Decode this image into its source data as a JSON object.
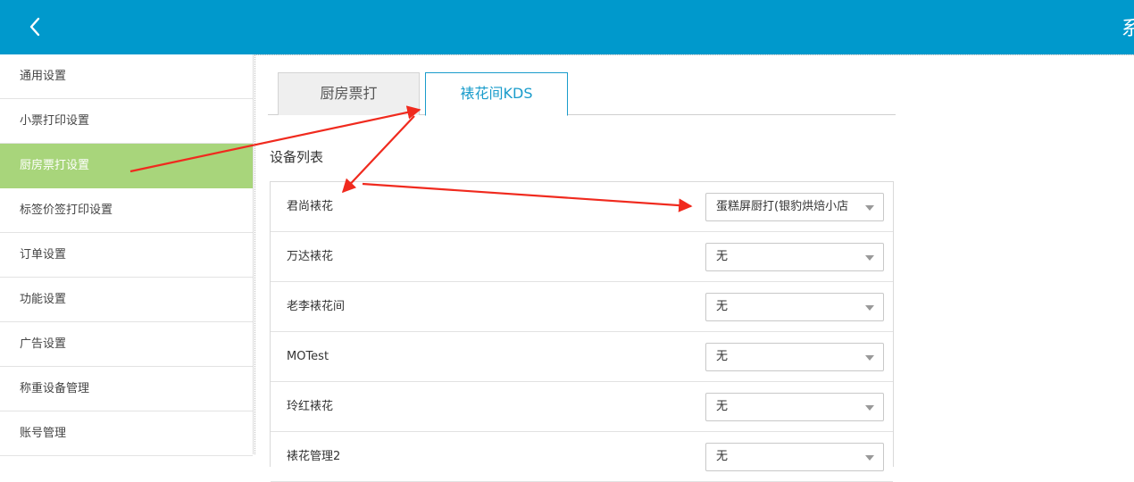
{
  "header": {
    "title": "系",
    "back_icon": "chevron-left-icon",
    "bg_color": "#0099cc"
  },
  "sidebar": {
    "active_color": "#a8d57b",
    "items": [
      {
        "label": "通用设置"
      },
      {
        "label": "小票打印设置"
      },
      {
        "label": "厨房票打设置",
        "active": true
      },
      {
        "label": "标签价签打印设置"
      },
      {
        "label": "订单设置"
      },
      {
        "label": "功能设置"
      },
      {
        "label": "广告设置"
      },
      {
        "label": "称重设备管理"
      },
      {
        "label": "账号管理"
      }
    ]
  },
  "tabs": [
    {
      "label": "厨房票打"
    },
    {
      "label": "裱花间KDS",
      "active": true
    }
  ],
  "device_list": {
    "title": "设备列表",
    "rows": [
      {
        "name": "君尚裱花",
        "value": "蛋糕屏厨打(银豹烘焙小店"
      },
      {
        "name": "万达裱花",
        "value": "无"
      },
      {
        "name": "老李裱花间",
        "value": "无"
      },
      {
        "name": "MOTest",
        "value": "无"
      },
      {
        "name": "玲红裱花",
        "value": "无"
      },
      {
        "name": "裱花管理2",
        "value": "无"
      }
    ]
  },
  "annotation_color": "#f02a1e"
}
